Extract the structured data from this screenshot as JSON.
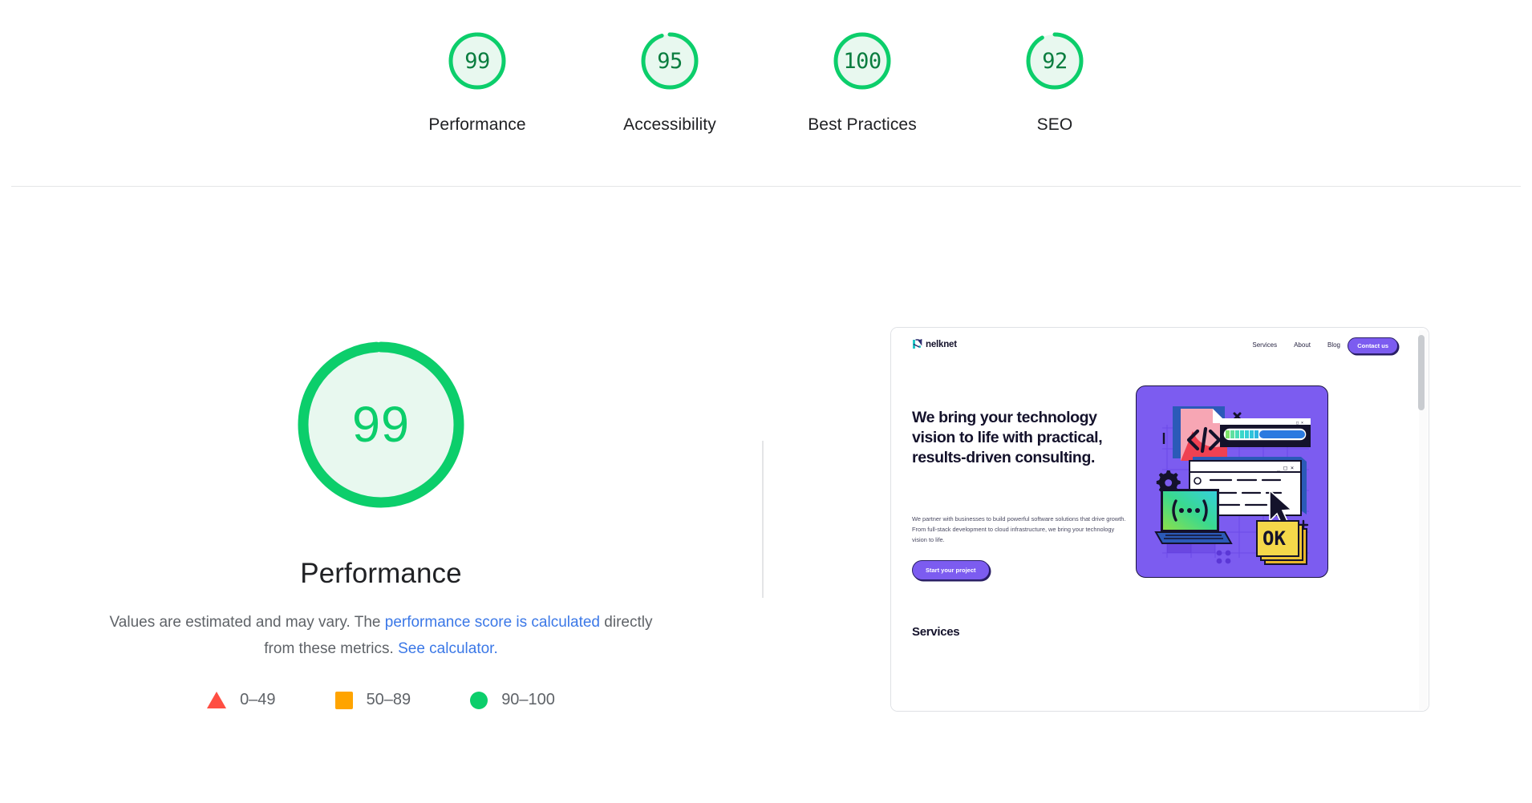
{
  "report": {
    "summary": {
      "categories": [
        {
          "label": "Performance",
          "score": 99,
          "gauge_pct": 99
        },
        {
          "label": "Accessibility",
          "score": 95,
          "gauge_pct": 95
        },
        {
          "label": "Best Practices",
          "score": 100,
          "gauge_pct": 100
        },
        {
          "label": "SEO",
          "score": 92,
          "gauge_pct": 92
        }
      ]
    },
    "detail": {
      "score": 99,
      "gauge_pct": 99,
      "title": "Performance",
      "disclaimer_part1": "Values are estimated and may vary. The ",
      "disclaimer_link1": "performance score is calculated",
      "disclaimer_part2": " directly from these metrics.",
      "disclaimer_link2": " See calculator.",
      "legend": [
        {
          "name": "fail-swatch",
          "range": "0–49"
        },
        {
          "name": "average-swatch",
          "range": "50–89"
        },
        {
          "name": "pass-swatch",
          "range": "90–100"
        }
      ]
    },
    "colors": {
      "pass": "#0cce6b",
      "average": "#ffa400",
      "fail": "#ff4e42",
      "pass_fill": "#e8f8ef",
      "link": "#3b78e7",
      "text_primary": "#202124",
      "text_secondary": "#5f6368"
    },
    "thumbnail": {
      "site": {
        "logo_text": "nelknet",
        "nav_links": [
          "Services",
          "About",
          "Blog"
        ],
        "contact_label": "Contact us",
        "hero_heading": "We bring your technology vision to life with practical, results-driven consulting.",
        "hero_paragraph": "We partner with businesses to build powerful software solutions that drive growth. From full-stack development to cloud infrastructure, we bring your technology vision to life.",
        "cta_label": "Start your project",
        "services_heading": "Services",
        "illustration": {
          "code_glyph": "</>",
          "braces_glyph": "{…}",
          "ok_label": "OK",
          "window_controls": "_ □ ×"
        }
      }
    }
  }
}
